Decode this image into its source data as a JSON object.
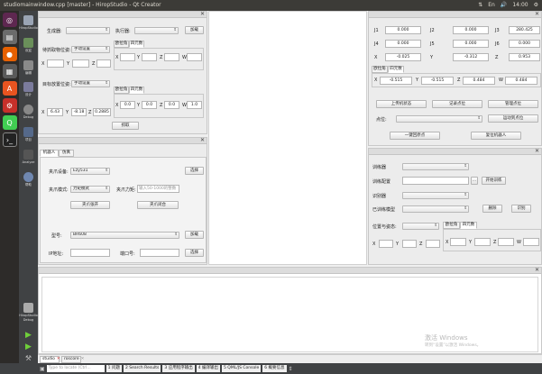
{
  "window_title": "studiomainwindow.cpp [master] - HiropStudio - Qt Creator",
  "tray": {
    "net": "⇅",
    "kbd": "En",
    "vol": "🔊",
    "time": "14:00",
    "power": "⚙"
  },
  "modebar": {
    "studio": "HiropStudio",
    "welcome": "欢迎",
    "edit": "编辑",
    "design": "设计",
    "debug": "Debug",
    "projects": "项目",
    "analyze": "Analyze",
    "help": "帮助",
    "kit_name": "HiropStudio",
    "kit_mode": "Debug"
  },
  "p1": {
    "gen_label": "生成器:",
    "exec_label": "执行器:",
    "load": "加载",
    "pick_pose_label": "待抓取物位姿:",
    "pick_mode": "手动设置",
    "x": "X",
    "y": "Y",
    "z": "Z",
    "w": "W",
    "tab_euler": "欧拉角",
    "tab_quat": "四元数",
    "target_label": "目标放置位姿:",
    "target_mode": "手动设置",
    "tx": "6.43",
    "ty": "-8.18",
    "tz": "0.2885",
    "qx": "0.0",
    "qy": "0.0",
    "qz": "0.0",
    "qw": "1.0",
    "plan": "抓取"
  },
  "p2": {
    "tab_robot": "机器人",
    "tab_sim": "仿真",
    "arm_label": "夹爪设备:",
    "arm_value": "Ezy531",
    "select": "选择",
    "mode_label": "夹爪模式:",
    "mode_value": "力矩模式",
    "force_label": "夹爪力矩:",
    "force_ph": "输入50-1000的整数",
    "open": "夹爪张开",
    "close": "夹爪闭合",
    "model_label": "型号:",
    "model_value": "BR608",
    "load": "加载",
    "ip_label": "IP地址:",
    "port_label": "端口号:",
    "select2": "选择"
  },
  "p3": {
    "j1": "J1",
    "j2": "J2",
    "j3": "J3",
    "j1v": "0.000",
    "j2v": "0.000",
    "j3v": "280.425",
    "j4": "J4",
    "j5": "J5",
    "j6": "J6",
    "j4v": "0.000",
    "j5v": "0.000",
    "j6v": "0.000",
    "x": "X",
    "y": "Y",
    "z": "Z",
    "xv": "-0.025",
    "yv": "-0.312",
    "zv": "0.953",
    "tab_euler": "欧拉角",
    "tab_quat": "四元数",
    "qx": "-0.515",
    "qy": "-0.515",
    "qz": "0.484",
    "qw": "0.484",
    "w": "W",
    "get_state": "上传机状态",
    "record": "记录点位",
    "manage": "管理点位",
    "point_label": "点位:",
    "move_to": "运动到点位",
    "home": "一键回原点",
    "reset": "复位机器人"
  },
  "p4": {
    "trainer": "训练器",
    "train_config": "训练配置",
    "start_train": "开始训练",
    "recognizer": "识别器",
    "trained_model": "已训练模型",
    "delete": "删除",
    "recognize": "识别",
    "pose_label": "位置与姿态:",
    "tab_euler": "欧拉角",
    "tab_quat": "四元数",
    "x": "X",
    "y": "Y",
    "z": "Z",
    "w": "W",
    "more": "..."
  },
  "status": {
    "locate_ph": "Type to locate (Ctrl...",
    "b1": "1 问题",
    "b2": "2 Search Results",
    "b3": "3 应用程序输出",
    "b4": "4 编译输出",
    "b5": "5 QML/JS Console",
    "b6": "6 概要信息"
  },
  "output_tabs": {
    "t1": "studio",
    "t2": "roscore"
  },
  "watermark": {
    "line1": "激活 Windows",
    "line2": "转到“设置”以激活 Windows。"
  }
}
